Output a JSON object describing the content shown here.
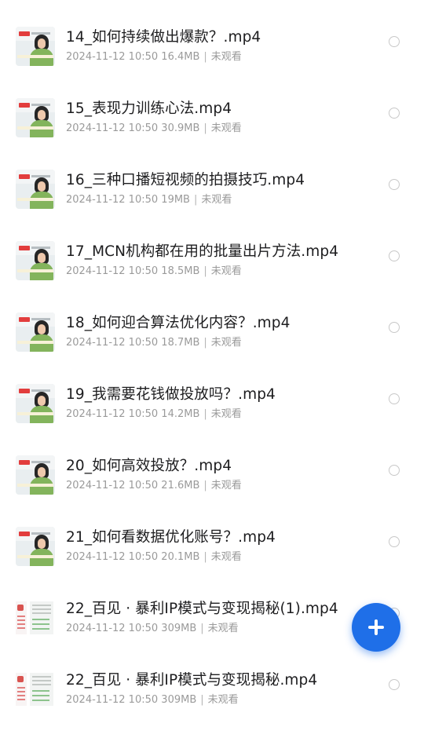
{
  "files": [
    {
      "title": "14_如何持续做出爆款？.mp4",
      "date": "2024-11-12 10:50",
      "size": "16.4MB",
      "status": "未观看",
      "thumb": "video-thumbnail"
    },
    {
      "title": "15_表现力训练心法.mp4",
      "date": "2024-11-12 10:50",
      "size": "30.9MB",
      "status": "未观看",
      "thumb": "video-thumbnail"
    },
    {
      "title": "16_三种口播短视频的拍摄技巧.mp4",
      "date": "2024-11-12 10:50",
      "size": "19MB",
      "status": "未观看",
      "thumb": "video-thumbnail"
    },
    {
      "title": "17_MCN机构都在用的批量出片方法.mp4",
      "date": "2024-11-12 10:50",
      "size": "18.5MB",
      "status": "未观看",
      "thumb": "video-thumbnail"
    },
    {
      "title": "18_如何迎合算法优化内容？.mp4",
      "date": "2024-11-12 10:50",
      "size": "18.7MB",
      "status": "未观看",
      "thumb": "video-thumbnail"
    },
    {
      "title": "19_我需要花钱做投放吗？.mp4",
      "date": "2024-11-12 10:50",
      "size": "14.2MB",
      "status": "未观看",
      "thumb": "video-thumbnail"
    },
    {
      "title": "20_如何高效投放？.mp4",
      "date": "2024-11-12 10:50",
      "size": "21.6MB",
      "status": "未观看",
      "thumb": "video-thumbnail"
    },
    {
      "title": "21_如何看数据优化账号？.mp4",
      "date": "2024-11-12 10:50",
      "size": "20.1MB",
      "status": "未观看",
      "thumb": "video-thumbnail"
    },
    {
      "title": "22_百见 · 暴利IP模式与变现揭秘(1).mp4",
      "date": "2024-11-12 10:50",
      "size": "309MB",
      "status": "未观看",
      "thumb": "document-thumbnail"
    },
    {
      "title": "22_百见 · 暴利IP模式与变现揭秘.mp4",
      "date": "2024-11-12 10:50",
      "size": "309MB",
      "status": "未观看",
      "thumb": "document-thumbnail"
    }
  ],
  "fab": {
    "icon": "plus-icon",
    "color": "#1f6fe8"
  }
}
